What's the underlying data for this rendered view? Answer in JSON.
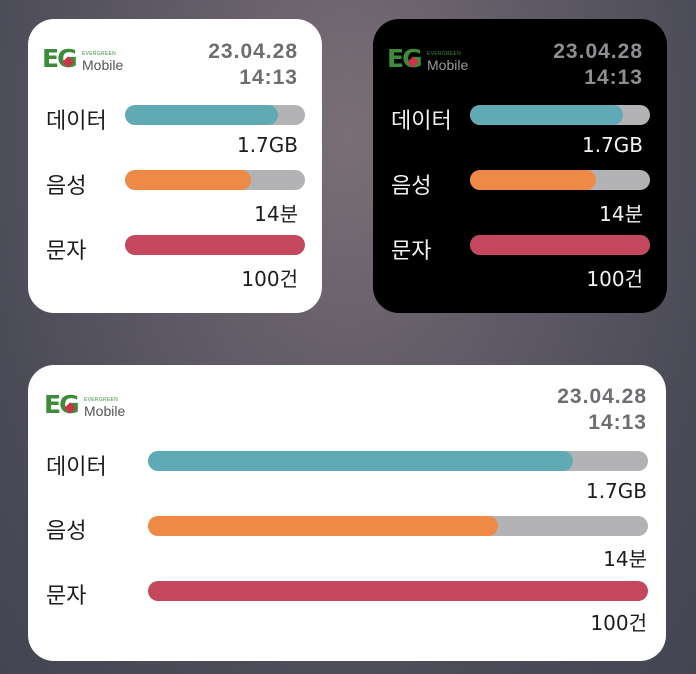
{
  "brand": {
    "letters": "EG",
    "tagline": "EVERGREEN",
    "name": "Mobile"
  },
  "datetime": {
    "date": "23.04.28",
    "time": "14:13"
  },
  "rows": [
    {
      "label": "데이터",
      "value": "1.7GB",
      "fraction": 0.85,
      "color": "#60aab6"
    },
    {
      "label": "음성",
      "value": "14분",
      "fraction": 0.7,
      "color": "#ef8a46"
    },
    {
      "label": "문자",
      "value": "100건",
      "fraction": 1.0,
      "color": "#c5475d"
    }
  ],
  "colors": {
    "track": "#b3b3b6",
    "date_light": "#6d6d72",
    "date_dark": "#8e8e93",
    "brand_green": "#3e8c3a",
    "brand_red": "#d0304a"
  }
}
